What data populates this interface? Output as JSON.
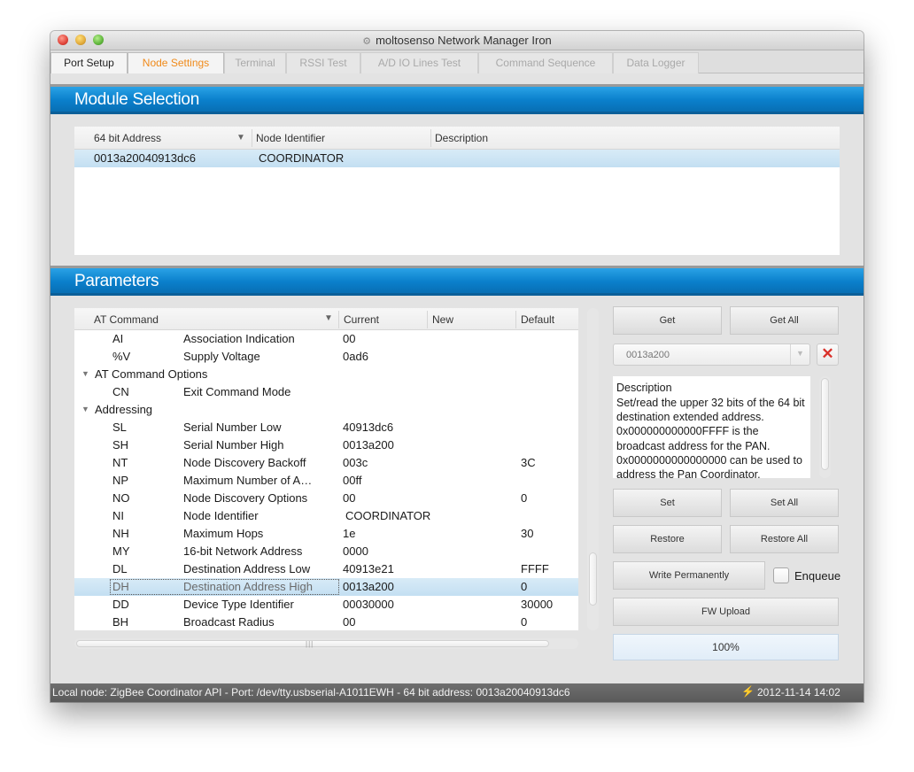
{
  "window": {
    "title": "moltosenso Network Manager Iron",
    "app_icon": "network-icon"
  },
  "tabs": [
    {
      "label": "Port Setup",
      "state": "normal"
    },
    {
      "label": "Node Settings",
      "state": "active"
    },
    {
      "label": "Terminal",
      "state": "disabled"
    },
    {
      "label": "RSSI Test",
      "state": "disabled"
    },
    {
      "label": "A/D IO Lines Test",
      "state": "disabled"
    },
    {
      "label": "Command Sequence",
      "state": "disabled"
    },
    {
      "label": "Data Logger",
      "state": "disabled"
    }
  ],
  "module_selection": {
    "title": "Module Selection",
    "columns": [
      "64 bit Address",
      "Node Identifier",
      "Description"
    ],
    "sort_icon": "sort-down-icon",
    "rows": [
      {
        "address": "0013a20040913dc6",
        "node_identifier": "COORDINATOR",
        "description": ""
      }
    ]
  },
  "parameters": {
    "title": "Parameters",
    "columns": [
      "AT Command",
      "Current",
      "New",
      "Default"
    ],
    "sort_icon": "sort-down-icon",
    "rows": [
      {
        "cmd": "AI",
        "name": "Association Indication",
        "current": "00",
        "new": "",
        "default": ""
      },
      {
        "cmd": "%V",
        "name": "Supply Voltage",
        "current": "0ad6",
        "new": "",
        "default": ""
      },
      {
        "group": "AT Command Options"
      },
      {
        "cmd": "CN",
        "name": "Exit Command Mode",
        "current": "",
        "new": "",
        "default": ""
      },
      {
        "group": "Addressing"
      },
      {
        "cmd": "SL",
        "name": "Serial Number Low",
        "current": "40913dc6",
        "new": "",
        "default": ""
      },
      {
        "cmd": "SH",
        "name": "Serial Number High",
        "current": "0013a200",
        "new": "",
        "default": ""
      },
      {
        "cmd": "NT",
        "name": "Node Discovery Backoff",
        "current": "003c",
        "new": "",
        "default": "3C"
      },
      {
        "cmd": "NP",
        "name": "Maximum Number of A…",
        "current": "00ff",
        "new": "",
        "default": ""
      },
      {
        "cmd": "NO",
        "name": "Node Discovery Options",
        "current": "00",
        "new": "",
        "default": "0"
      },
      {
        "cmd": "NI",
        "name": "Node Identifier",
        "current": "COORDINATOR",
        "new": "",
        "default": ""
      },
      {
        "cmd": "NH",
        "name": "Maximum Hops",
        "current": "1e",
        "new": "",
        "default": "30"
      },
      {
        "cmd": "MY",
        "name": "16-bit Network Address",
        "current": "0000",
        "new": "",
        "default": ""
      },
      {
        "cmd": "DL",
        "name": "Destination Address Low",
        "current": "40913e21",
        "new": "",
        "default": "FFFF"
      },
      {
        "cmd": "DH",
        "name": "Destination Address High",
        "current": "0013a200",
        "new": "",
        "default": "0",
        "selected": true
      },
      {
        "cmd": "DD",
        "name": "Device Type Identifier",
        "current": "00030000",
        "new": "",
        "default": "30000"
      },
      {
        "cmd": "BH",
        "name": "Broadcast Radius",
        "current": "00",
        "new": "",
        "default": "0"
      }
    ]
  },
  "controls": {
    "get": "Get",
    "get_all": "Get All",
    "combo_value": "0013a200",
    "clear_icon": "close-icon",
    "description_title": "Description",
    "description_text": "Set/read the upper 32 bits of the 64 bit destination extended address. 0x000000000000FFFF is the broadcast address for the PAN. 0x0000000000000000 can be used to address the Pan Coordinator.",
    "set": "Set",
    "set_all": "Set All",
    "restore": "Restore",
    "restore_all": "Restore All",
    "write_permanently": "Write Permanently",
    "enqueue_label": "Enqueue",
    "enqueue_checked": false,
    "fw_upload": "FW Upload",
    "progress_text": "100%",
    "progress_fraction": 1.0
  },
  "statusbar": {
    "text": "Local node: ZigBee Coordinator API - Port: /dev/tty.usbserial-A1011EWH - 64 bit address: 0013a20040913dc6",
    "icon": "connection-plug-icon",
    "datetime": "2012-11-14 14:02"
  },
  "colors": {
    "accent": "#0a7fcb",
    "active_tab": "#f08a1a",
    "selection": "#c9e2f4",
    "status_bar": "#636363"
  }
}
